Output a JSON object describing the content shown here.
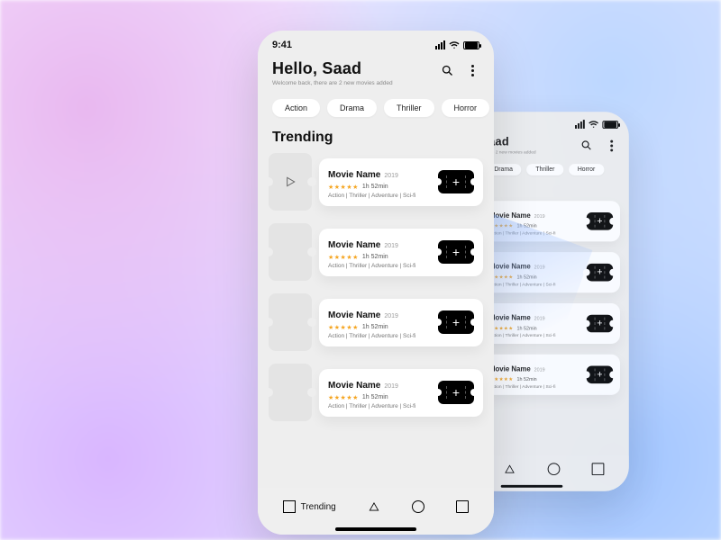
{
  "status": {
    "time": "9:41"
  },
  "header": {
    "greeting": "Hello, Saad",
    "subtitle": "Welcome back, there are 2 new movies added"
  },
  "chips": [
    "Action",
    "Drama",
    "Thriller",
    "Horror"
  ],
  "section_title": "Trending",
  "movies": [
    {
      "title": "Movie Name",
      "year": "2019",
      "stars": "★★★★★",
      "runtime": "1h 52min",
      "genres": "Action | Thriller | Adventure | Sci-fi",
      "has_play_icon": true
    },
    {
      "title": "Movie Name",
      "year": "2019",
      "stars": "★★★★★",
      "runtime": "1h 52min",
      "genres": "Action | Thriller | Adventure | Sci-fi",
      "has_play_icon": false
    },
    {
      "title": "Movie Name",
      "year": "2019",
      "stars": "★★★★★",
      "runtime": "1h 52min",
      "genres": "Action | Thriller | Adventure | Sci-fi",
      "has_play_icon": false
    },
    {
      "title": "Movie Name",
      "year": "2019",
      "stars": "★★★★★",
      "runtime": "1h 52min",
      "genres": "Action | Thriller | Adventure | Sci-fi",
      "has_play_icon": false
    }
  ],
  "tabs": {
    "active_label": "Trending"
  }
}
